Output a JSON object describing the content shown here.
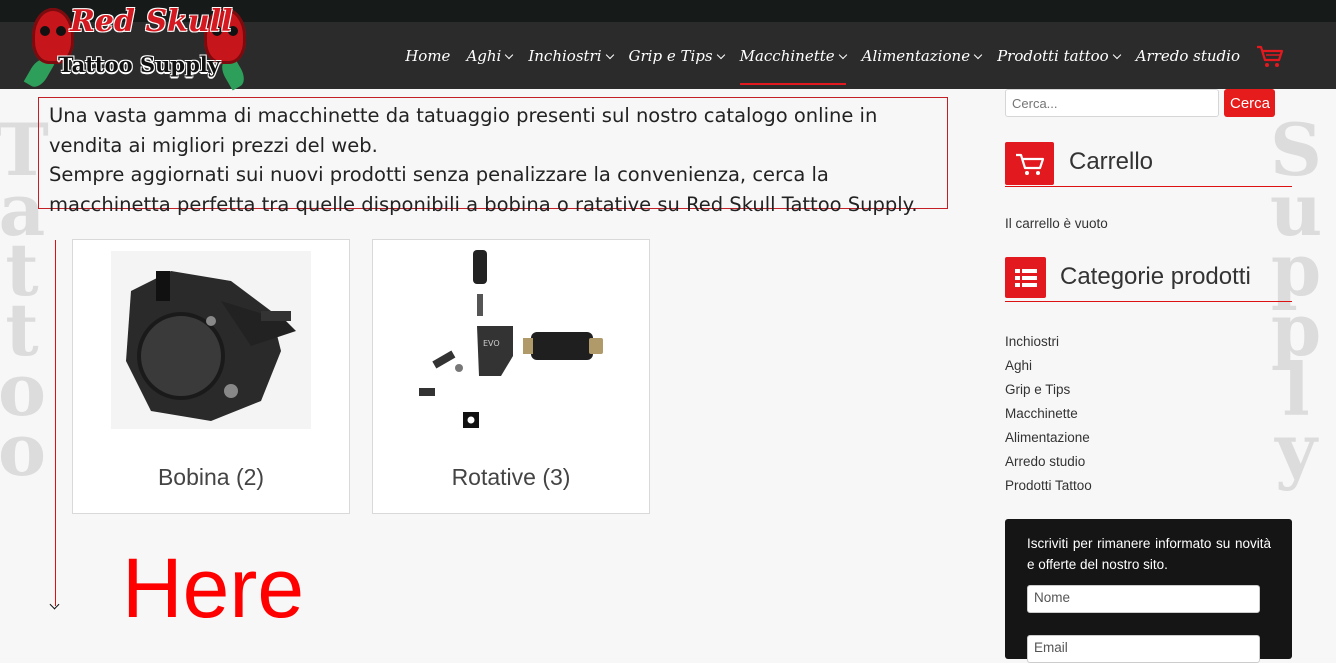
{
  "brand": {
    "name_top": "Red Skull",
    "name_bottom": "Tattoo Supply"
  },
  "nav": {
    "items": [
      {
        "label": "Home",
        "chevron": false,
        "active": false
      },
      {
        "label": "Aghi",
        "chevron": true,
        "active": false
      },
      {
        "label": "Inchiostri",
        "chevron": true,
        "active": false
      },
      {
        "label": "Grip e Tips",
        "chevron": true,
        "active": false
      },
      {
        "label": "Macchinette",
        "chevron": true,
        "active": true
      },
      {
        "label": "Alimentazione",
        "chevron": true,
        "active": false
      },
      {
        "label": "Prodotti tattoo",
        "chevron": true,
        "active": false
      },
      {
        "label": "Arredo studio",
        "chevron": false,
        "active": false
      }
    ],
    "cart_icon": "cart-icon"
  },
  "watermark": {
    "left": "Tattoo",
    "right": "Supply"
  },
  "intro": {
    "line1": "Una vasta gamma di macchinette da tatuaggio presenti sul nostro catalogo online in vendita ai migliori prezzi del web.",
    "line2": "Sempre aggiornati sui nuovi prodotti senza penalizzare la convenienza, cerca la macchinetta perfetta tra quelle disponibili a bobina o ratative su Red Skull Tattoo Supply."
  },
  "categories_grid": [
    {
      "label": "Bobina (2)"
    },
    {
      "label": "Rotative (3)"
    }
  ],
  "annotation": {
    "text": "Here",
    "color": "#ff0000"
  },
  "sidebar": {
    "search": {
      "placeholder": "Cerca...",
      "button": "Cerca"
    },
    "cart": {
      "title": "Carrello",
      "empty_text": "Il carrello è vuoto"
    },
    "categories": {
      "title": "Categorie prodotti",
      "items": [
        "Inchiostri",
        "Aghi",
        "Grip e Tips",
        "Macchinette",
        "Alimentazione",
        "Arredo studio",
        "Prodotti Tattoo"
      ]
    },
    "newsletter": {
      "text": "Iscriviti per rimanere informato su novità e offerte del nostro sito.",
      "name_placeholder": "Nome",
      "email_placeholder": "Email"
    }
  },
  "colors": {
    "accent": "#e2191f",
    "nav_bg": "#2b2b2b",
    "top_bg": "#161a19"
  }
}
